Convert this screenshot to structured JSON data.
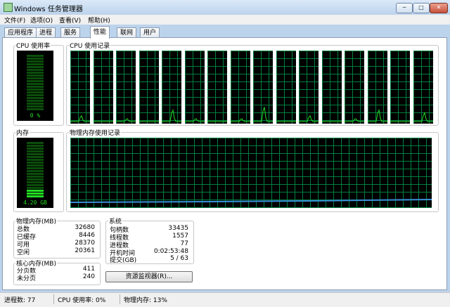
{
  "window": {
    "title": "Windows 任务管理器",
    "min_glyph": "─",
    "max_glyph": "□",
    "close_glyph": "✕"
  },
  "menu": [
    "文件(F)",
    "选项(O)",
    "查看(V)",
    "帮助(H)"
  ],
  "tabs": [
    {
      "label": "应用程序",
      "active": false
    },
    {
      "label": "进程",
      "active": false
    },
    {
      "label": "服务",
      "active": false
    },
    {
      "label": "性能",
      "active": true
    },
    {
      "label": "联网",
      "active": false
    },
    {
      "label": "用户",
      "active": false
    }
  ],
  "cpu": {
    "title": "CPU 使用率",
    "value": "0 %",
    "level": 0.0
  },
  "cpu_history": {
    "title": "CPU 使用记录",
    "core_count": 16
  },
  "memory": {
    "title": "内存",
    "value": "4.20 GB",
    "level": 0.13
  },
  "memory_history": {
    "title": "物理内存使用记录"
  },
  "physical_memory": {
    "title": "物理内存(MB)",
    "rows": [
      {
        "label": "总数",
        "value": "32680"
      },
      {
        "label": "已缓存",
        "value": "8446"
      },
      {
        "label": "可用",
        "value": "28370"
      },
      {
        "label": "空闲",
        "value": "20361"
      }
    ]
  },
  "kernel_memory": {
    "title": "核心内存(MB)",
    "rows": [
      {
        "label": "分页数",
        "value": "411"
      },
      {
        "label": "未分页",
        "value": "240"
      }
    ]
  },
  "system": {
    "title": "系统",
    "rows": [
      {
        "label": "句柄数",
        "value": "33435"
      },
      {
        "label": "线程数",
        "value": "1557"
      },
      {
        "label": "进程数",
        "value": "77"
      },
      {
        "label": "开机时间",
        "value": "0:02:53:48"
      },
      {
        "label": "提交(GB)",
        "value": "5 / 63"
      }
    ]
  },
  "resource_monitor_button": "资源监视器(R)...",
  "status": {
    "processes": "进程数: 77",
    "cpu": "CPU 使用率: 0%",
    "memory": "物理内存: 13%"
  },
  "colors": {
    "graph_bg": "#000000",
    "grid": "#008040",
    "trace": "#22dd22",
    "memory_trace": "#3a8fd8"
  }
}
